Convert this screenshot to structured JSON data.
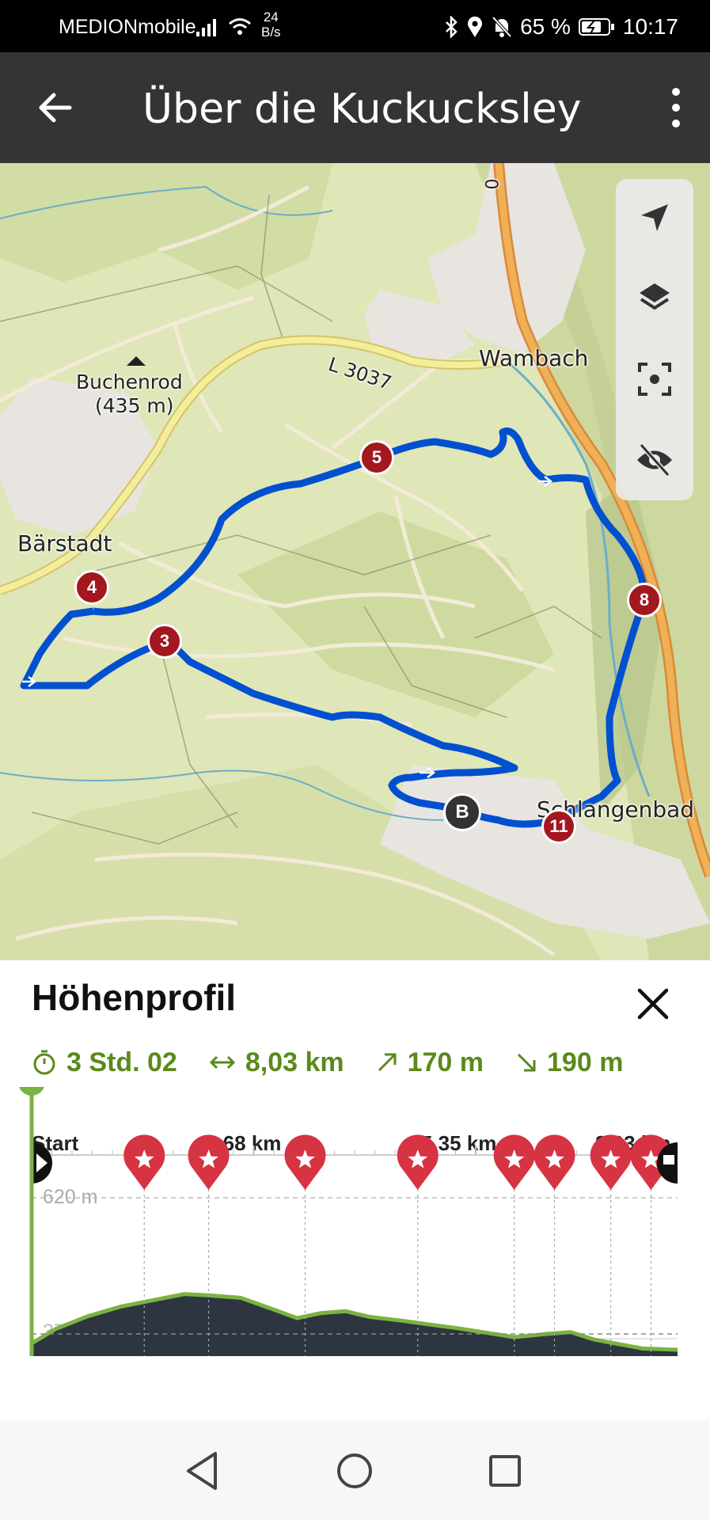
{
  "status_bar": {
    "carrier": "MEDIONmobile",
    "net_speed_value": "24",
    "net_speed_unit": "B/s",
    "battery": "65 %",
    "time": "10:17",
    "icons": [
      "signal-icon",
      "wifi-icon",
      "bluetooth-icon",
      "location-icon",
      "mute-icon",
      "battery-icon"
    ]
  },
  "app_bar": {
    "title": "Über die Kuckucksley",
    "icons": [
      "back-arrow-icon",
      "more-vert-icon"
    ]
  },
  "map": {
    "labels": {
      "buchenrod": "Buchenrod",
      "buchenrod_elev": "(435 m)",
      "baerstadt": "Bärstadt",
      "wambach": "Wambach",
      "road": "L 3037",
      "schlangenbad": "Schlangenbad",
      "road_partial": "0"
    },
    "waypoints": [
      "3",
      "4",
      "5",
      "8",
      "11"
    ],
    "bus_marker": "B",
    "route_color": "#0050d0",
    "controls": [
      "navigate-icon",
      "layers-icon",
      "recenter-icon",
      "hide-icon"
    ]
  },
  "elevation_panel": {
    "title": "Höhenprofil",
    "stats": {
      "duration": "3 Std. 02",
      "distance": "8,03 km",
      "ascent": "170 m",
      "descent": "190 m"
    },
    "km_labels": [
      "Start",
      "2,68 km",
      "5,35 km",
      "8,03 km"
    ],
    "y_labels": {
      "top": "620 m",
      "bottom": "370 m"
    },
    "accent_color": "#7bb342",
    "fill_color": "#2d3540",
    "marker_color": "#d63343"
  },
  "chart_data": {
    "type": "area",
    "xlabel": "",
    "ylabel": "",
    "x_unit": "km",
    "y_unit": "m",
    "xlim": [
      0,
      8.03
    ],
    "ylim": [
      370,
      620
    ],
    "x": [
      0,
      0.3,
      0.7,
      1.1,
      1.5,
      1.9,
      2.2,
      2.6,
      3.0,
      3.3,
      3.6,
      3.9,
      4.2,
      4.6,
      5.0,
      5.3,
      5.6,
      6.0,
      6.4,
      6.7,
      7.0,
      7.3,
      7.6,
      8.03
    ],
    "y": [
      390,
      413,
      433,
      448,
      458,
      468,
      466,
      462,
      444,
      430,
      438,
      441,
      432,
      426,
      419,
      414,
      408,
      400,
      405,
      408,
      396,
      389,
      382,
      380
    ],
    "poi_markers_km": [
      1.4,
      2.2,
      3.4,
      4.8,
      6.0,
      6.5,
      7.2,
      7.7
    ],
    "start_marker": "play",
    "finish_marker": "flag"
  }
}
